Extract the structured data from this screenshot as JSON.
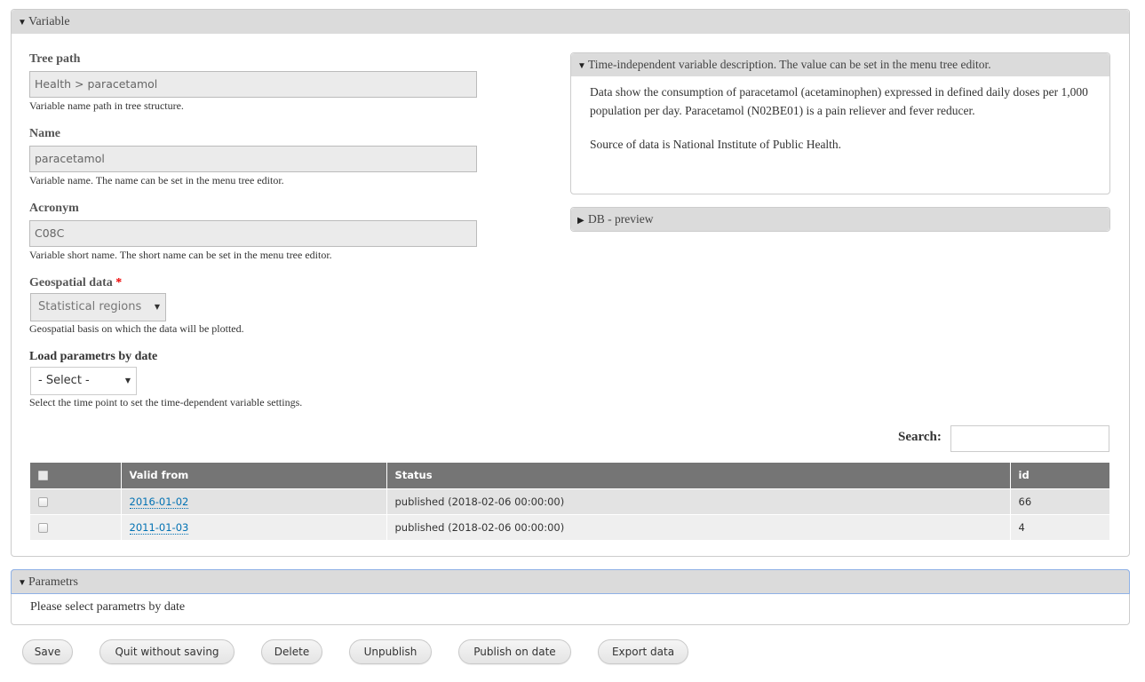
{
  "variable_section": {
    "legend": "Variable",
    "tree_path": {
      "label": "Tree path",
      "value": "Health > paracetamol",
      "help": "Variable name path in tree structure."
    },
    "name": {
      "label": "Name",
      "value": "paracetamol",
      "help": "Variable name. The name can be set in the menu tree editor."
    },
    "acronym": {
      "label": "Acronym",
      "value": "C08C",
      "help": "Variable short name. The short name can be set in the menu tree editor."
    },
    "geospatial": {
      "label": "Geospatial data",
      "required_mark": "*",
      "selected": "Statistical regions",
      "help": "Geospatial basis on which the data will be plotted."
    },
    "load_by_date": {
      "label": "Load parametrs by date",
      "selected": "- Select -",
      "help": "Select the time point to set the time-dependent variable settings."
    },
    "description": {
      "legend": "Time-independent variable description. The value can be set in the menu tree editor.",
      "paragraphs": [
        "Data show the consumption of paracetamol (acetaminophen) expressed in defined daily doses per 1,000 population per day. Paracetamol (N02BE01) is a pain reliever and fever reducer.",
        "Source of data is National Institute of Public Health."
      ]
    },
    "db_preview": {
      "legend": "DB - preview"
    },
    "search": {
      "label": "Search:",
      "value": ""
    },
    "table": {
      "columns": [
        "",
        "Valid from",
        "Status",
        "id"
      ],
      "rows": [
        {
          "valid_from": "2016-01-02",
          "status": "published (2018-02-06 00:00:00)",
          "id": "66"
        },
        {
          "valid_from": "2011-01-03",
          "status": "published (2018-02-06 00:00:00)",
          "id": "4"
        }
      ]
    }
  },
  "parametrs_section": {
    "legend": "Parametrs",
    "body": "Please select parametrs by date"
  },
  "actions": {
    "save": "Save",
    "quit": "Quit without saving",
    "delete": "Delete",
    "unpublish": "Unpublish",
    "publish_on_date": "Publish on date",
    "export": "Export data"
  },
  "icons": {
    "expanded": "▼",
    "collapsed": "▶",
    "select_arrow": "▼"
  },
  "colors": {
    "link": "#0071b3",
    "table_header": "#757575",
    "legend_bg": "#dbdbdb",
    "required": "#ee0000",
    "focus_border": "#8fb1e6"
  }
}
